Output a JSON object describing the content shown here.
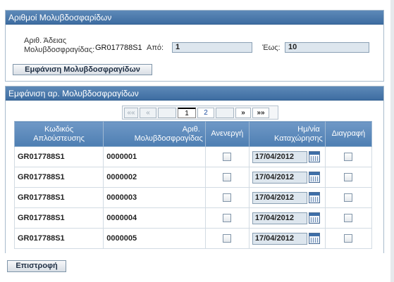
{
  "section1": {
    "title": "Αριθμοί Μολυβδοσφαρίδων",
    "license_label_line1": "Αριθ. Άδειας",
    "license_label_line2": "Μολυβδοσφραγίδας:",
    "license_value": "GR017788S1",
    "from_label": "Από:",
    "from_value": "1",
    "to_label": "Έως:",
    "to_value": "10",
    "show_button": "Εμφάνιση Μολυβδοσφραγίδων"
  },
  "section2": {
    "title": "Εμφάνιση αρ. Μολυβδοσφραγίδων",
    "pager": {
      "first": "««",
      "prev": "«",
      "page1": "1",
      "page2": "2",
      "next": "»",
      "last": "»»"
    },
    "headers": {
      "code_line1": "Κωδικός",
      "code_line2": "Απλούστευσης",
      "seal_line1": "Αριθ.",
      "seal_line2": "Μολυβδοσφραγίδας",
      "inactive": "Ανενεργή",
      "date_line1": "Ημ/νία",
      "date_line2": "Καταχώρησης",
      "delete": "Διαγραφή"
    },
    "rows": [
      {
        "code": "GR017788S1",
        "seal": "0000001",
        "date": "17/04/2012"
      },
      {
        "code": "GR017788S1",
        "seal": "0000002",
        "date": "17/04/2012"
      },
      {
        "code": "GR017788S1",
        "seal": "0000003",
        "date": "17/04/2012"
      },
      {
        "code": "GR017788S1",
        "seal": "0000004",
        "date": "17/04/2012"
      },
      {
        "code": "GR017788S1",
        "seal": "0000005",
        "date": "17/04/2012"
      }
    ]
  },
  "footer": {
    "back_button": "Επιστροφή"
  }
}
